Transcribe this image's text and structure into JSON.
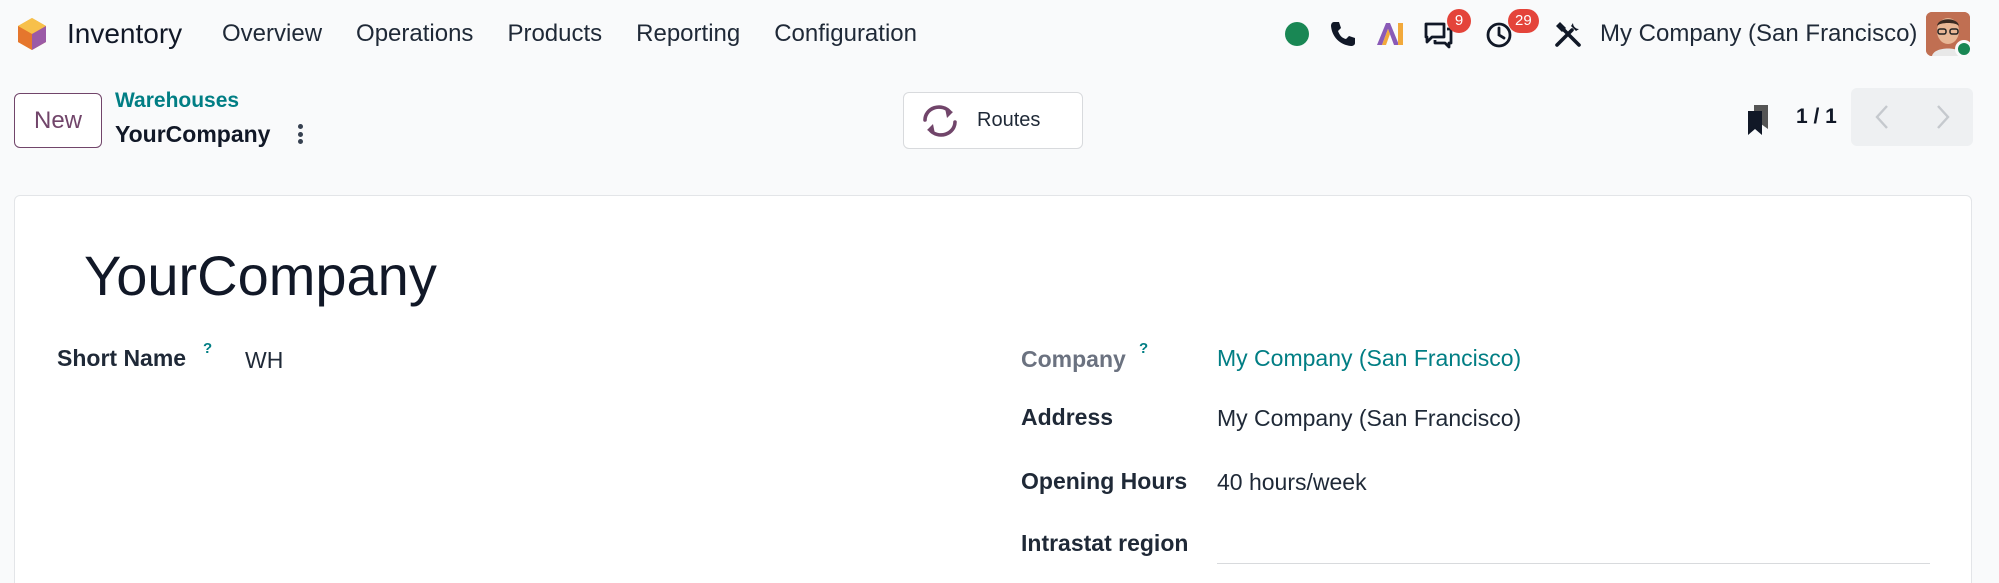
{
  "navbar": {
    "app_name": "Inventory",
    "menu": [
      "Overview",
      "Operations",
      "Products",
      "Reporting",
      "Configuration"
    ],
    "messages_badge": "9",
    "activities_badge": "29",
    "company": "My Company (San Francisco)",
    "icons": [
      "presence-dot",
      "phone-icon",
      "ai-icon",
      "chat-icon",
      "clock-icon",
      "tools-icon"
    ]
  },
  "control_panel": {
    "new_label": "New",
    "breadcrumb_parent": "Warehouses",
    "breadcrumb_current": "YourCompany",
    "routes_label": "Routes",
    "pager_value": "1 / 1"
  },
  "form": {
    "title": "YourCompany",
    "short_name_label": "Short Name",
    "short_name_help": "?",
    "short_name_value": "WH",
    "company_label": "Company",
    "company_help": "?",
    "company_value": "My Company (San Francisco)",
    "address_label": "Address",
    "address_value": "My Company (San Francisco)",
    "opening_hours_label": "Opening Hours",
    "opening_hours_value": "40 hours/week",
    "intrastat_label": "Intrastat region",
    "intrastat_value": ""
  },
  "colors": {
    "brand": "#71456a",
    "link": "#017e84",
    "badge": "#e4443a",
    "online": "#198754"
  }
}
